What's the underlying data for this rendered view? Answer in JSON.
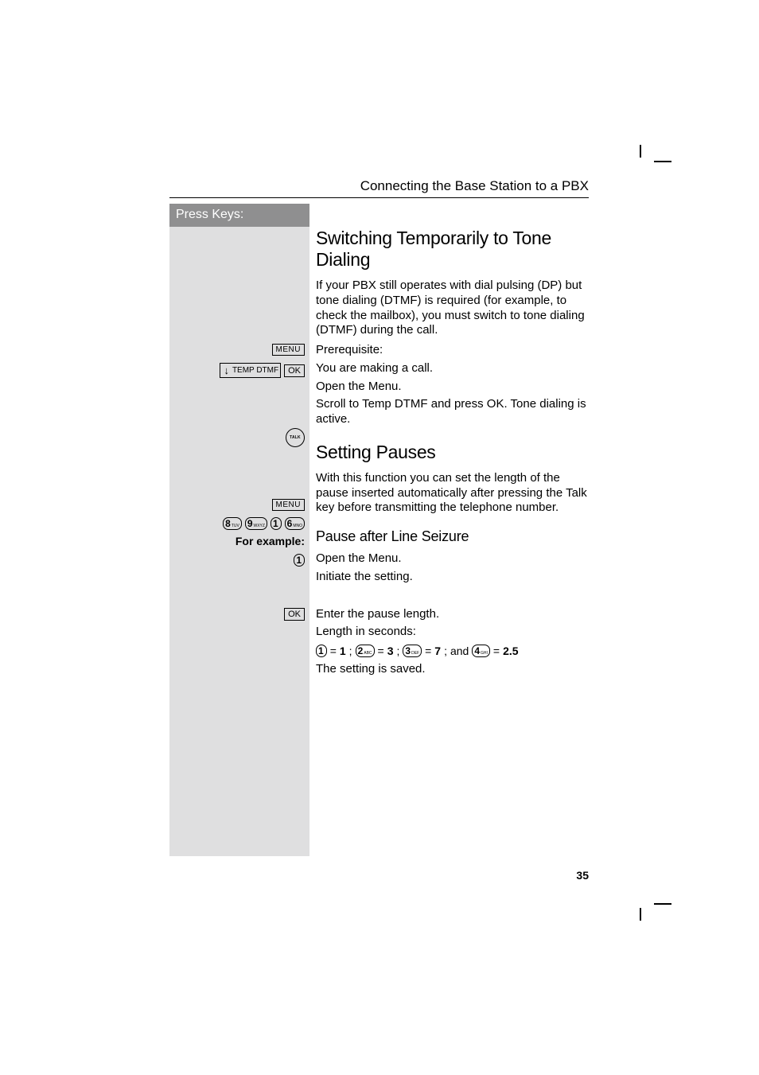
{
  "header": {
    "title": "Connecting the Base Station to a PBX"
  },
  "press_keys_label": "Press Keys:",
  "sections": {
    "tone": {
      "heading": "Switching Temporarily to Tone Dialing",
      "intro": "If your PBX still operates with dial pulsing (DP) but tone dialing (DTMF) is required (for example, to check the mailbox), you must switch to tone dialing (DTMF) during the call.",
      "prereq_label": "Prerequisite:",
      "prereq_text": "You are making a call.",
      "menu_action": "Open the Menu.",
      "scroll_action": "Scroll to Temp DTMF and press OK. Tone dialing is active."
    },
    "pauses": {
      "heading": "Setting Pauses",
      "talk_desc": "With this function you can set the length of the pause inserted automatically after pressing the Talk key before transmitting the telephone number.",
      "sub_heading": "Pause after Line Seizure",
      "menu_action": "Open the Menu.",
      "initiate": "Initiate the setting.",
      "for_example": "For example:",
      "enter_pause": "Enter the pause length.",
      "length_label": "Length in seconds:",
      "saved": "The setting is saved."
    }
  },
  "keys": {
    "menu": "MENU",
    "ok": "OK",
    "temp_dtmf": "TEMP DTMF",
    "down_arrow": "↓",
    "talk": "TALK",
    "d1": {
      "digit": "1",
      "letters": ""
    },
    "d2": {
      "digit": "2",
      "letters": "ABC"
    },
    "d3": {
      "digit": "3",
      "letters": "DEF"
    },
    "d4": {
      "digit": "4",
      "letters": "GHI"
    },
    "d6": {
      "digit": "6",
      "letters": "MNO"
    },
    "d8": {
      "digit": "8",
      "letters": "TUV"
    },
    "d9": {
      "digit": "9",
      "letters": "WXYZ"
    }
  },
  "equation": {
    "eq": "=",
    "v1": "1",
    "v2": "3",
    "v3": "7",
    "v4": "2.5",
    "sep": ";",
    "and": "and"
  },
  "page_number": "35"
}
